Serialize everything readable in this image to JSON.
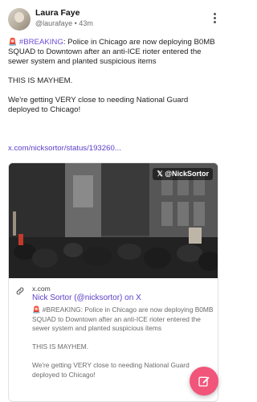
{
  "author": {
    "name": "Laura Faye",
    "handle_line": "@laurafaye • 43m"
  },
  "post": {
    "line1_hashtag": "#BREAKING",
    "line1_rest": ": Police in Chicago are now deploying B0MB SQUAD to Downtown after an anti-ICE rioter entered the sewer system and planted suspicious items",
    "line2": "THIS IS MAYHEM.",
    "line3": "We're getting VERY close to needing National Guard deployed to Chicago!",
    "link": "x.com/nicksortor/status/193260..."
  },
  "card": {
    "media_tag": "𝕏 @NickSortor",
    "domain": "x.com",
    "title": "Nick Sortor (@nicksortor) on X",
    "desc_line1": "🚨 #BREAKING: Police in Chicago are now deploying B0MB SQUAD to Downtown after an anti-ICE rioter entered the sewer system and planted suspicious items",
    "desc_line2": "THIS IS MAYHEM.",
    "desc_line3": "We're getting VERY close to needing National Guard deployed to Chicago!"
  },
  "icons": {
    "siren": "siren-emoji",
    "more": "kebab-icon",
    "link": "link-icon",
    "compose": "compose-icon"
  },
  "colors": {
    "accent": "#5b3ec8",
    "hashtag": "#6e4ad6",
    "fab": "#f1557a"
  }
}
